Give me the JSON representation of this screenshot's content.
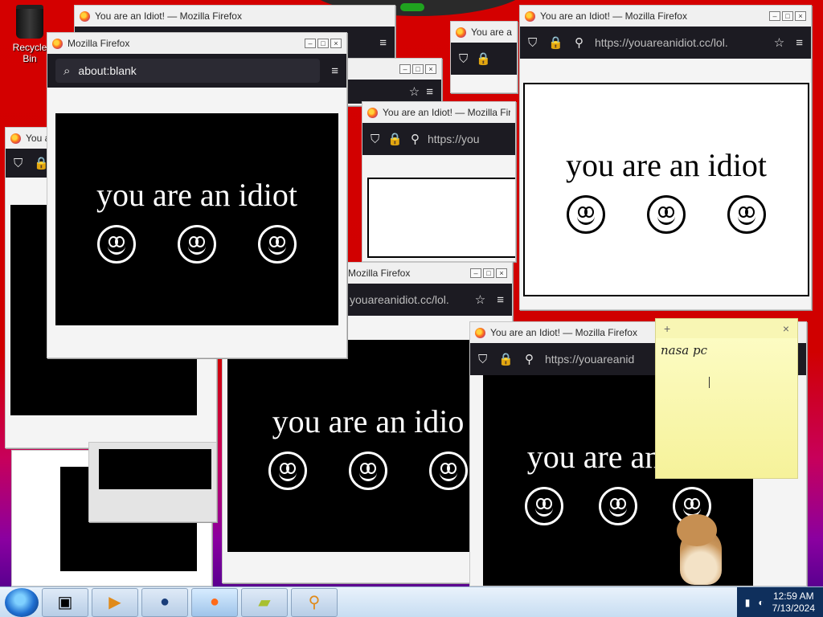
{
  "desktop": {
    "recycle_bin_label": "Recycle Bin"
  },
  "window_title": "You are an Idiot! — Mozilla Firefox",
  "window_title_short": "Mozilla Firefox",
  "url": "https://youareanidiot.cc/lol.",
  "url_tail": "youareanidiot.cc/lol.",
  "url_partial": "https://youareanid",
  "url_partial2": "https://you",
  "blank_url": "about:blank",
  "page_text": "you are an idiot",
  "page_text_partial": "you are an",
  "page_text_partial2": "you are an idio",
  "sticky_note": {
    "text": "nasa pc",
    "add_label": "+",
    "close_label": "×"
  },
  "taskbar": {
    "items": [
      {
        "name": "computer",
        "icon": "computer-icon"
      },
      {
        "name": "media",
        "icon": "media-icon"
      },
      {
        "name": "globe",
        "icon": "globe-icon"
      },
      {
        "name": "firefox",
        "icon": "firefox-icon"
      },
      {
        "name": "sticky-notes",
        "icon": "notes-icon"
      },
      {
        "name": "search",
        "icon": "magnifier-icon"
      }
    ],
    "clock_time": "12:59 AM",
    "clock_date": "7/13/2024"
  }
}
